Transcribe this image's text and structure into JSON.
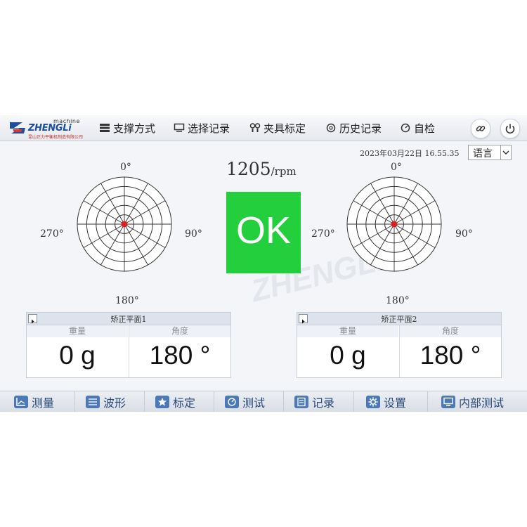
{
  "header": {
    "logo": {
      "top_text": "machine",
      "brand": "ZHENGLi",
      "sub": "昆山正力平衡机制造有限公司"
    },
    "menu": [
      {
        "label": "支撑方式",
        "icon": "server-icon"
      },
      {
        "label": "选择记录",
        "icon": "monitor-icon"
      },
      {
        "label": "夹具标定",
        "icon": "fixture-icon"
      },
      {
        "label": "历史记录",
        "icon": "history-icon"
      },
      {
        "label": "自检",
        "icon": "gauge-icon"
      }
    ],
    "link_icon": "link-icon",
    "power_icon": "power-icon"
  },
  "status": {
    "datetime": "2023年03月22日  16.55.35",
    "language_label": "语言"
  },
  "speed": {
    "value": "1205",
    "unit": "/rpm"
  },
  "result": {
    "label": "OK",
    "color": "#23cf3c"
  },
  "polar_plots": [
    {
      "labels": {
        "top": "0°",
        "right": "90°",
        "bottom": "180°",
        "left": "270°"
      },
      "point_color": "#e02020"
    },
    {
      "labels": {
        "top": "0°",
        "right": "90°",
        "bottom": "180°",
        "left": "270°"
      },
      "point_color": "#e02020"
    }
  ],
  "planes": [
    {
      "title": "矫正平面1",
      "weight_header": "重量",
      "angle_header": "角度",
      "weight": "0 g",
      "angle": "180 °"
    },
    {
      "title": "矫正平面2",
      "weight_header": "重量",
      "angle_header": "角度",
      "weight": "0 g",
      "angle": "180 °"
    }
  ],
  "tabs": [
    {
      "label": "测量",
      "icon": "chart-icon"
    },
    {
      "label": "波形",
      "icon": "wave-icon"
    },
    {
      "label": "标定",
      "icon": "star-icon"
    },
    {
      "label": "测试",
      "icon": "dial-icon"
    },
    {
      "label": "记录",
      "icon": "clipboard-icon"
    },
    {
      "label": "设置",
      "icon": "gear-icon"
    },
    {
      "label": "内部测试",
      "icon": "monitor-icon"
    }
  ],
  "colors": {
    "accent": "#1d4f9e",
    "ok_green": "#23cf3c",
    "tab_icon": "#4b79b8"
  }
}
